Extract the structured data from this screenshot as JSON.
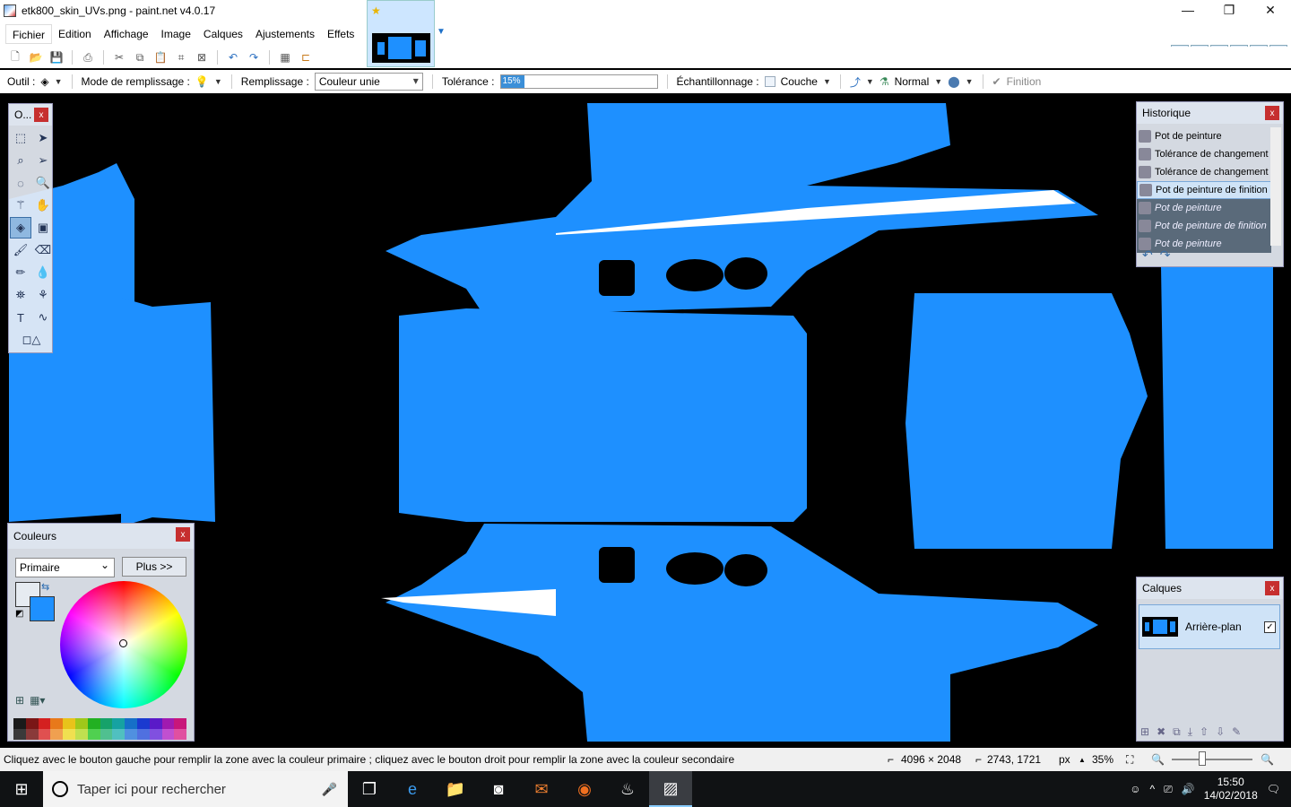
{
  "window": {
    "title": "etk800_skin_UVs.png - paint.net v4.0.17",
    "buttons": [
      "—",
      "❐",
      "✕"
    ]
  },
  "menu": [
    "Fichier",
    "Edition",
    "Affichage",
    "Image",
    "Calques",
    "Ajustements",
    "Effets"
  ],
  "options": {
    "tool_label": "Outil :",
    "fill_mode_label": "Mode de remplissage :",
    "fill_label": "Remplissage :",
    "fill_value": "Couleur unie",
    "tolerance_label": "Tolérance :",
    "tolerance_value": "15%",
    "tolerance_fraction": 0.15,
    "sampling_label": "Échantillonnage :",
    "sampling_value": "Couche",
    "blend_value": "Normal",
    "finish_label": "Finition"
  },
  "tools_panel": {
    "title": "O..."
  },
  "history": {
    "title": "Historique",
    "items": [
      {
        "label": "Pot de peinture",
        "state": "done"
      },
      {
        "label": "Tolérance de changement",
        "state": "done"
      },
      {
        "label": "Tolérance de changement",
        "state": "done"
      },
      {
        "label": "Pot de peinture de finition",
        "state": "selected"
      },
      {
        "label": "Pot de peinture",
        "state": "redo"
      },
      {
        "label": "Pot de peinture de finition",
        "state": "redo"
      },
      {
        "label": "Pot de peinture",
        "state": "redo"
      }
    ]
  },
  "layers": {
    "title": "Calques",
    "layer_name": "Arrière-plan",
    "visible": true
  },
  "colors": {
    "title": "Couleurs",
    "select_value": "Primaire",
    "more_button": "Plus >>",
    "primary": "#e6ebf1",
    "secondary": "#1e90ff",
    "palette": [
      "#1a1a1a",
      "#7a1616",
      "#d42020",
      "#e8791a",
      "#e8c31a",
      "#9ec81a",
      "#22b022",
      "#16a26a",
      "#16a2a2",
      "#1670c8",
      "#1a3ad0",
      "#5a1ac8",
      "#a01ab0",
      "#c8167a",
      "#3a3a3a",
      "#8a3a3a",
      "#e05050",
      "#f0a050",
      "#f0e050",
      "#c0e050",
      "#50d050",
      "#50c090",
      "#50c0c0",
      "#5090e0",
      "#5070e0",
      "#8050e0",
      "#c050d0",
      "#e050a0"
    ]
  },
  "status": {
    "hint": "Cliquez avec le bouton gauche pour remplir la zone avec la couleur primaire ; cliquez avec le bouton droit pour remplir la zone avec la couleur secondaire",
    "image_size": "4096 × 2048",
    "cursor_pos": "2743, 1721",
    "unit": "px",
    "zoom": "35%"
  },
  "taskbar": {
    "search_placeholder": "Taper ici pour rechercher",
    "time": "15:50",
    "date": "14/02/2018"
  },
  "canvas_colors": {
    "body": "#1e90ff",
    "background": "#000000",
    "highlight": "#ffffff"
  }
}
